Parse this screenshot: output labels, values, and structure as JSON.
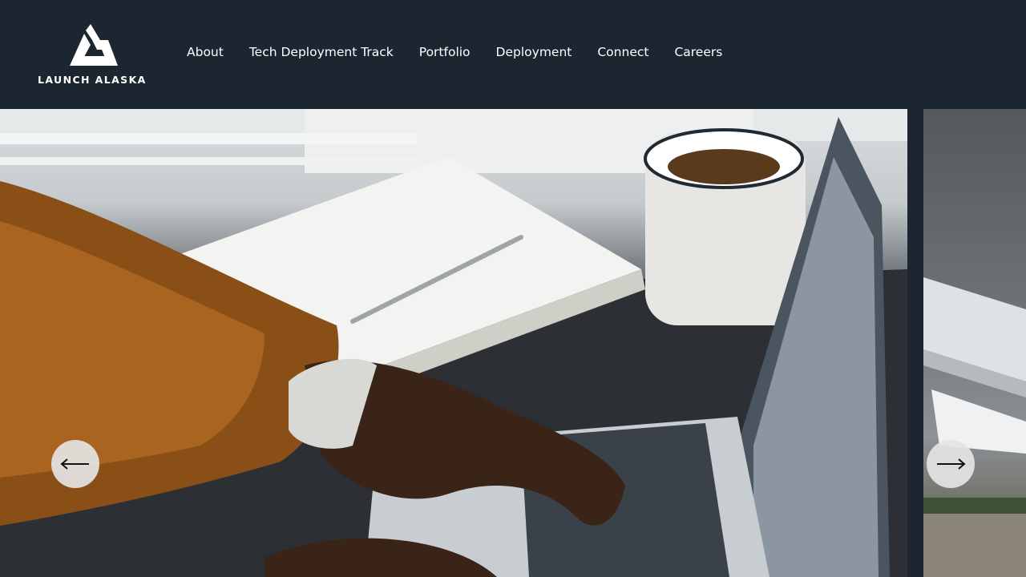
{
  "brand": {
    "logo_text": "LAUNCH ALASKA"
  },
  "nav": {
    "items": [
      {
        "label": "About"
      },
      {
        "label": "Tech Deployment Track"
      },
      {
        "label": "Portfolio"
      },
      {
        "label": "Deployment"
      },
      {
        "label": "Connect"
      },
      {
        "label": "Careers"
      }
    ]
  },
  "carousel": {
    "prev_icon": "arrow-left-icon",
    "next_icon": "arrow-right-icon"
  },
  "colors": {
    "header_bg": "#1b2630",
    "text": "#ffffff",
    "arrow_bg": "#e4e4e4"
  }
}
